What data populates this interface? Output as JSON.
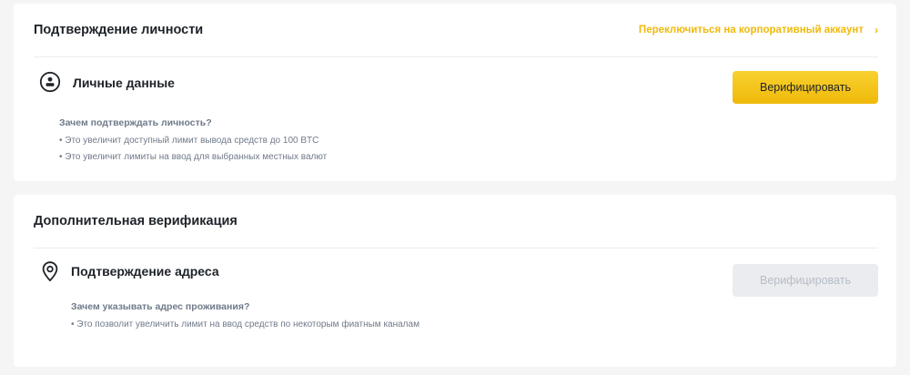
{
  "identity": {
    "title": "Подтверждение личности",
    "switch_link": "Переключиться на корпоративный аккаунт",
    "switch_chevron": "›",
    "section_icon": "user-circle-icon",
    "section_title": "Личные данные",
    "verify_label": "Верифицировать",
    "why_title": "Зачем подтверждать личность?",
    "bullets": [
      "• Это увеличит доступный лимит вывода средств до 100 BTC",
      "• Это увеличит лимиты на ввод для выбранных местных валют"
    ]
  },
  "additional": {
    "title": "Дополнительная верификация",
    "section_icon": "location-pin-icon",
    "section_title": "Подтверждение адреса",
    "verify_label": "Верифицировать",
    "why_title": "Зачем указывать адрес проживания?",
    "bullets": [
      "• Это позволит увеличить лимит на ввод средств по некоторым фиатным каналам"
    ]
  },
  "colors": {
    "accent": "#f0b90b",
    "text_primary": "#1e2329",
    "text_secondary": "#707a8a",
    "disabled_bg": "#eaecef",
    "disabled_text": "#b7bdc6"
  }
}
